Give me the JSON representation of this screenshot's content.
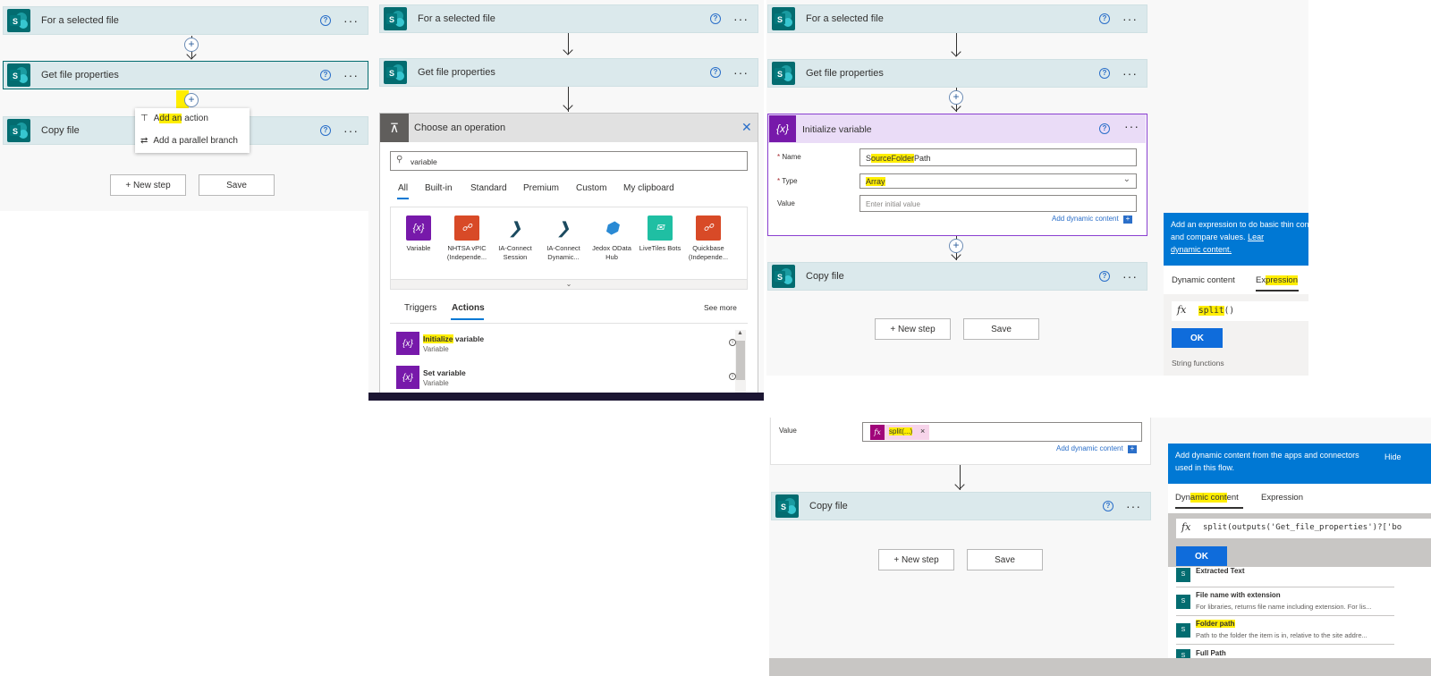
{
  "panel1": {
    "card1": "For a selected file",
    "card2": "Get file properties",
    "card3": "Copy file",
    "menu_add_action": {
      "pre": "A",
      "hl": "dd an",
      "post": " action"
    },
    "menu_parallel": "Add a parallel branch",
    "new_step": "+ New step",
    "save": "Save"
  },
  "panel2": {
    "card1": "For a selected file",
    "card2": "Get file properties",
    "dialog_title": "Choose an operation",
    "search_value": "variable",
    "tabs": [
      "All",
      "Built-in",
      "Standard",
      "Premium",
      "Custom",
      "My clipboard"
    ],
    "connectors": [
      {
        "label": "Variable",
        "color": "#7719aa",
        "glyph": "{x}"
      },
      {
        "label": "NHTSA vPIC (Independe...",
        "color": "#d84a27",
        "glyph": "☍"
      },
      {
        "label": "IA-Connect Session",
        "color": "#ffffff",
        "glyph": "❯"
      },
      {
        "label": "IA-Connect Dynamic...",
        "color": "#ffffff",
        "glyph": "❯"
      },
      {
        "label": "Jedox OData Hub",
        "color": "#ffffff",
        "glyph": "⬢"
      },
      {
        "label": "LiveTiles Bots",
        "color": "#1fbfa3",
        "glyph": "✉"
      },
      {
        "label": "Quickbase (Independe...",
        "color": "#d84a27",
        "glyph": "☍"
      }
    ],
    "sub_tabs": [
      "Triggers",
      "Actions"
    ],
    "see_more": "See more",
    "actions": [
      {
        "title_hl": "Initialize",
        "title_rest": " variable",
        "subtitle": "Variable"
      },
      {
        "title_hl": "",
        "title_rest": "Set variable",
        "subtitle": "Variable"
      }
    ]
  },
  "panel3": {
    "card1": "For a selected file",
    "card2": "Get file properties",
    "init_title": "Initialize variable",
    "name_label": "Name",
    "name_value": {
      "pre": "S",
      "hl": "ourceFolder",
      "post": "Path"
    },
    "type_label": "Type",
    "type_value": "Array",
    "value_label": "Value",
    "value_placeholder": "Enter initial value",
    "add_dynamic": "Add dynamic content",
    "card_copy": "Copy file",
    "new_step": "+ New step",
    "save": "Save",
    "expr_panel_text": "Add an expression to do basic thin convert, and compare values.",
    "expr_panel_link": "Lear",
    "expr_panel_link2": "dynamic content.",
    "tab_dynamic": "Dynamic content",
    "tab_expression": {
      "pre": "Ex",
      "hl": "pression",
      "post": ""
    },
    "expr_value": {
      "hl": "split",
      "post": "()"
    },
    "ok": "OK",
    "string_functions": "String functions"
  },
  "panel4": {
    "value_label": "Value",
    "token_label": "split(...)",
    "add_dynamic": "Add dynamic content",
    "card_copy": "Copy file",
    "new_step": "+ New step",
    "save": "Save",
    "dyn_panel_text": "Add dynamic content from the apps and connectors used in this flow.",
    "hide": "Hide",
    "tab_dynamic": {
      "pre": "Dyn",
      "hl": "amic cont",
      "post": "ent"
    },
    "tab_expression": "Expression",
    "expr_value": "split(outputs('Get_file_properties')?['bo",
    "ok": "OK",
    "items": [
      {
        "title": "Extracted Text",
        "desc": ""
      },
      {
        "title": "File name with extension",
        "desc": "For libraries, returns file name including extension. For lis..."
      },
      {
        "title": "Folder path",
        "desc": "Path to the folder the item is in, relative to the site addre..."
      },
      {
        "title": "Full Path",
        "desc": ""
      }
    ]
  },
  "colors": {
    "card_bg": "#dbe9ec",
    "sharepoint": "#036c70",
    "variable_purple": "#7719aa",
    "highlight": "#ffee00",
    "primary_blue": "#0078d4"
  }
}
